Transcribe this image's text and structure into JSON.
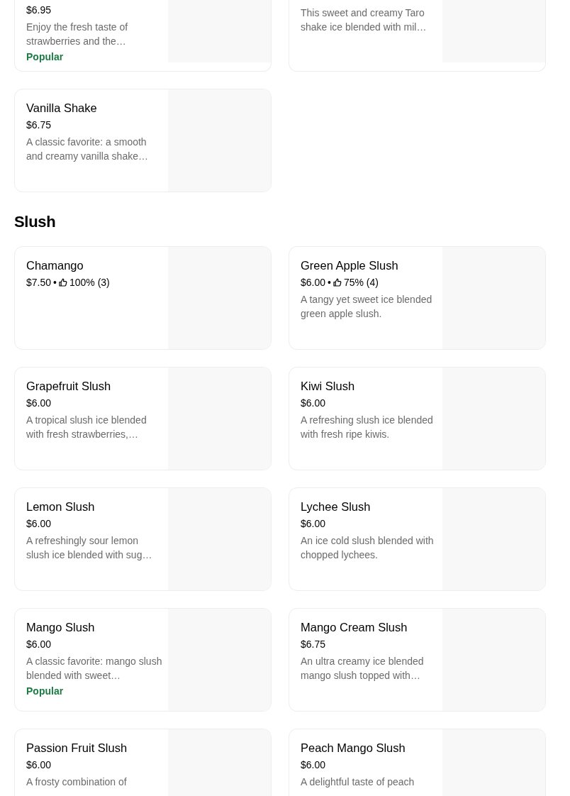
{
  "sections": [
    {
      "items": [
        {
          "price": "$6.95",
          "description": "Enjoy the fresh taste of strawberries and the…",
          "badge": "Popular"
        },
        {
          "description": "This sweet and creamy Taro shake ice blended with mil…"
        },
        {
          "name": "Vanilla Shake",
          "price": "$6.75",
          "description": "A classic favorite: a smooth and creamy vanilla shake…"
        }
      ]
    },
    {
      "title": "Slush",
      "items": [
        {
          "name": "Chamango",
          "price": "$7.50",
          "separator": "•",
          "rating": "100% (3)"
        },
        {
          "name": "Green Apple Slush",
          "price": "$6.00",
          "separator": "•",
          "rating": "75% (4)",
          "description": "A tangy yet sweet ice blended green apple slush."
        },
        {
          "name": "Grapefruit  Slush",
          "price": "$6.00",
          "description": "A tropical slush ice blended with fresh strawberries,…"
        },
        {
          "name": "Kiwi Slush",
          "price": "$6.00",
          "description": "A refreshing slush ice blended with fresh ripe kiwis."
        },
        {
          "name": "Lemon Slush",
          "price": "$6.00",
          "description": "A refreshingly sour lemon slush ice blended with sug…"
        },
        {
          "name": "Lychee Slush",
          "price": "$6.00",
          "description": "An ice cold slush blended with chopped lychees."
        },
        {
          "name": "Mango Slush",
          "price": "$6.00",
          "description": "A classic favorite: mango slush blended with sweet…",
          "badge": "Popular"
        },
        {
          "name": "Mango Cream Slush",
          "price": "$6.75",
          "description": "An ultra creamy ice blended mango slush topped with…"
        },
        {
          "name": "Passion Fruit Slush",
          "price": "$6.00",
          "description": "A frosty combination of"
        },
        {
          "name": "Peach Mango Slush",
          "price": "$6.00",
          "description": "A delightful taste of peach"
        }
      ]
    }
  ]
}
